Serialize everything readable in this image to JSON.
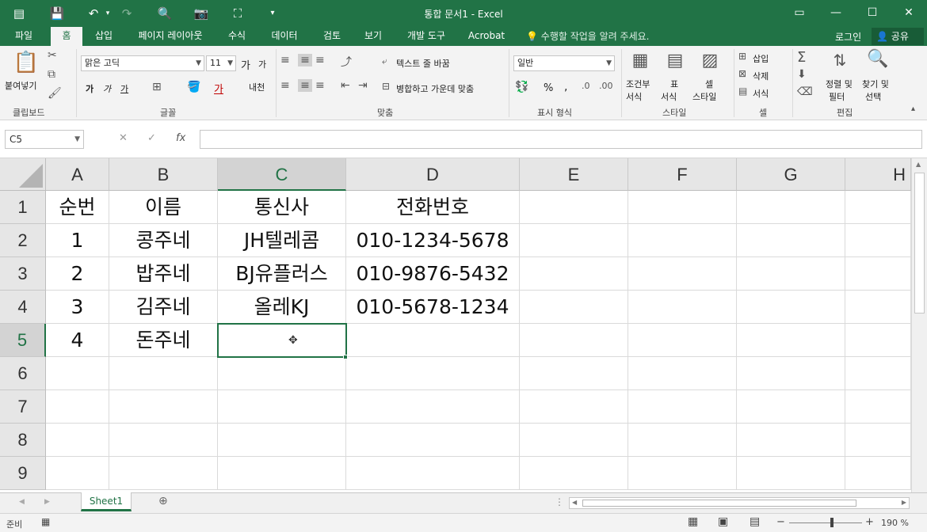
{
  "title": "통합 문서1 - Excel",
  "tabs": [
    "파일",
    "홈",
    "삽입",
    "페이지 레이아웃",
    "수식",
    "데이터",
    "검토",
    "보기",
    "개발 도구",
    "Acrobat"
  ],
  "tell_me": "수행할 작업을 알려 주세요.",
  "login": "로그인",
  "share": "공유",
  "ribbon": {
    "clipboard": {
      "paste": "붙여넣기",
      "label": "클립보드"
    },
    "font": {
      "name": "맑은 고딕",
      "size": "11",
      "grow": "가",
      "shrink": "가",
      "bold": "가",
      "italic": "가",
      "underline": "가",
      "phonetic": "내천",
      "color_a": "가",
      "label": "글꼴"
    },
    "align": {
      "wrap": "텍스트 줄 바꿈",
      "merge": "병합하고 가운데 맞춤",
      "label": "맞춤"
    },
    "number": {
      "format": "일반",
      "percent": "%",
      "comma": ",",
      "label": "표시 형식"
    },
    "styles": {
      "conditional": "조건부\n서식",
      "conditional_1": "조건부",
      "conditional_2": "서식",
      "table_1": "표",
      "table_2": "서식",
      "cell_1": "셀",
      "cell_2": "스타일",
      "label": "스타일"
    },
    "cells": {
      "insert": "삽입",
      "delete": "삭제",
      "format": "서식",
      "label": "셀"
    },
    "edit": {
      "sort_1": "정렬 및",
      "sort_2": "필터",
      "find_1": "찾기 및",
      "find_2": "선택",
      "label": "편집"
    }
  },
  "formula_bar": {
    "name_box": "C5",
    "fx": "fx",
    "value": ""
  },
  "columns": [
    "A",
    "B",
    "C",
    "D",
    "E",
    "F",
    "G",
    "H"
  ],
  "rows": [
    "1",
    "2",
    "3",
    "4",
    "5",
    "6",
    "7",
    "8",
    "9"
  ],
  "selected_cell": "C5",
  "cells": [
    [
      "순번",
      "이름",
      "통신사",
      "전화번호"
    ],
    [
      "1",
      "콩주네",
      "JH텔레콤",
      "010-1234-5678"
    ],
    [
      "2",
      "밥주네",
      "BJ유플러스",
      "010-9876-5432"
    ],
    [
      "3",
      "김주네",
      "올레KJ",
      "010-5678-1234"
    ],
    [
      "4",
      "돈주네",
      "",
      ""
    ]
  ],
  "sheet_tabs": [
    "Sheet1"
  ],
  "status": {
    "ready": "준비",
    "zoom": "190 %"
  },
  "colors": {
    "accent": "#217346",
    "ribbon_bg": "#f3f3f3",
    "header_bg": "#e6e6e6",
    "gridline": "#dadada"
  }
}
